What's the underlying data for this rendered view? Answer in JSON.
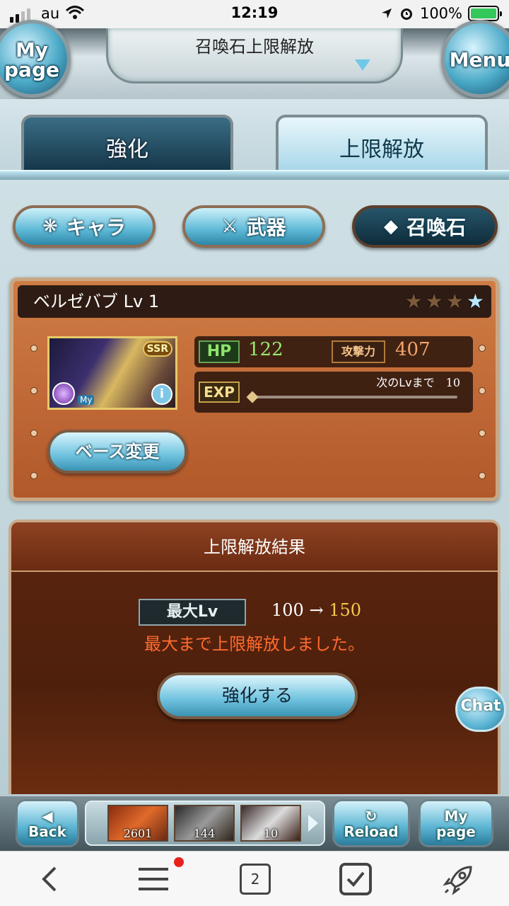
{
  "status_bar": {
    "carrier": "au",
    "time": "12:19",
    "battery": "100%"
  },
  "header": {
    "title": "召喚石上限解放",
    "left_orb_line1": "My",
    "left_orb_line2": "page",
    "right_orb": "Menu"
  },
  "tabs": [
    {
      "label": "強化",
      "active": false
    },
    {
      "label": "上限解放",
      "active": true
    }
  ],
  "filters": [
    {
      "label": "キャラ",
      "icon": "character-icon",
      "selected": false
    },
    {
      "label": "武器",
      "icon": "weapon-icon",
      "selected": false
    },
    {
      "label": "召喚石",
      "icon": "crystal-icon",
      "selected": true
    }
  ],
  "summon": {
    "name_level": "ベルゼバブ Lv 1",
    "stars_total": 4,
    "stars_lit": 1,
    "rarity": "SSR",
    "badge_my": "My",
    "hp_label": "HP",
    "hp": "122",
    "atk_label": "攻撃力",
    "atk": "407",
    "exp_label": "EXP",
    "next_label": "次のLvまで",
    "next_value": "10",
    "exp_fraction": 0.0
  },
  "base_change_label": "ベース変更",
  "result": {
    "title": "上限解放結果",
    "max_lv_label": "最大Lv",
    "from": "100",
    "arrow": "→",
    "to": "150",
    "message": "最大まで上限解放しました。",
    "enhance_button": "強化する"
  },
  "chat_label": "Chat",
  "gamebar": {
    "back": "Back",
    "reload": "Reload",
    "mypage_line1": "My",
    "mypage_line2": "page",
    "items": [
      {
        "count": "2601"
      },
      {
        "count": "144"
      },
      {
        "count": "10"
      }
    ]
  },
  "browser_nav": {
    "tab_count": "2"
  },
  "colors": {
    "accent_blue": "#5db8d6",
    "panel_brown": "#b2582a",
    "result_red": "#ff6b2e",
    "level_gold": "#f6c84c"
  }
}
